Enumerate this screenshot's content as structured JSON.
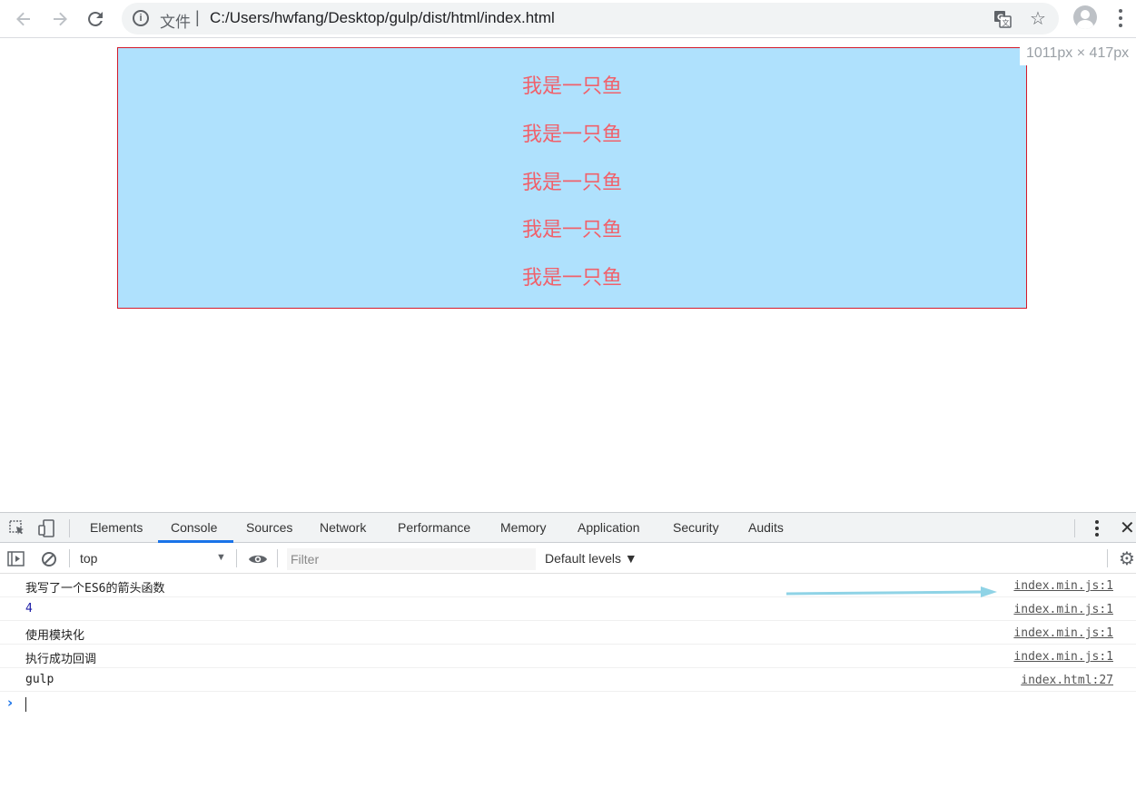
{
  "browser": {
    "scheme_label": "文件",
    "separator": "|",
    "url": "C:/Users/hwfang/Desktop/gulp/dist/html/index.html",
    "back_icon": "arrow-left-icon",
    "forward_icon": "arrow-right-icon",
    "reload_icon": "reload-icon"
  },
  "page": {
    "fish_lines": [
      "我是一只鱼",
      "我是一只鱼",
      "我是一只鱼",
      "我是一只鱼",
      "我是一只鱼"
    ],
    "size_tag": "1011px × 417px",
    "colors": {
      "box_bg": "#afe1fd",
      "box_border": "#d31a2a",
      "text": "#f0616b"
    }
  },
  "devtools": {
    "tabs": [
      {
        "label": "Elements",
        "active": false
      },
      {
        "label": "Console",
        "active": true
      },
      {
        "label": "Sources",
        "active": false
      },
      {
        "label": "Network",
        "active": false
      },
      {
        "label": "Performance",
        "active": false
      },
      {
        "label": "Memory",
        "active": false
      },
      {
        "label": "Application",
        "active": false
      },
      {
        "label": "Security",
        "active": false
      },
      {
        "label": "Audits",
        "active": false
      }
    ],
    "console": {
      "context": "top",
      "filter_placeholder": "Filter",
      "levels_label": "Default levels ▼",
      "messages": [
        {
          "text": "我写了一个ES6的箭头函数",
          "source": "index.min.js:1",
          "type": "text"
        },
        {
          "text": "4",
          "source": "index.min.js:1",
          "type": "number"
        },
        {
          "text": "使用模块化",
          "source": "index.min.js:1",
          "type": "text"
        },
        {
          "text": "执行成功回调",
          "source": "index.min.js:1",
          "type": "text"
        },
        {
          "text": "gulp",
          "source": "index.html:27",
          "type": "text"
        }
      ]
    }
  }
}
